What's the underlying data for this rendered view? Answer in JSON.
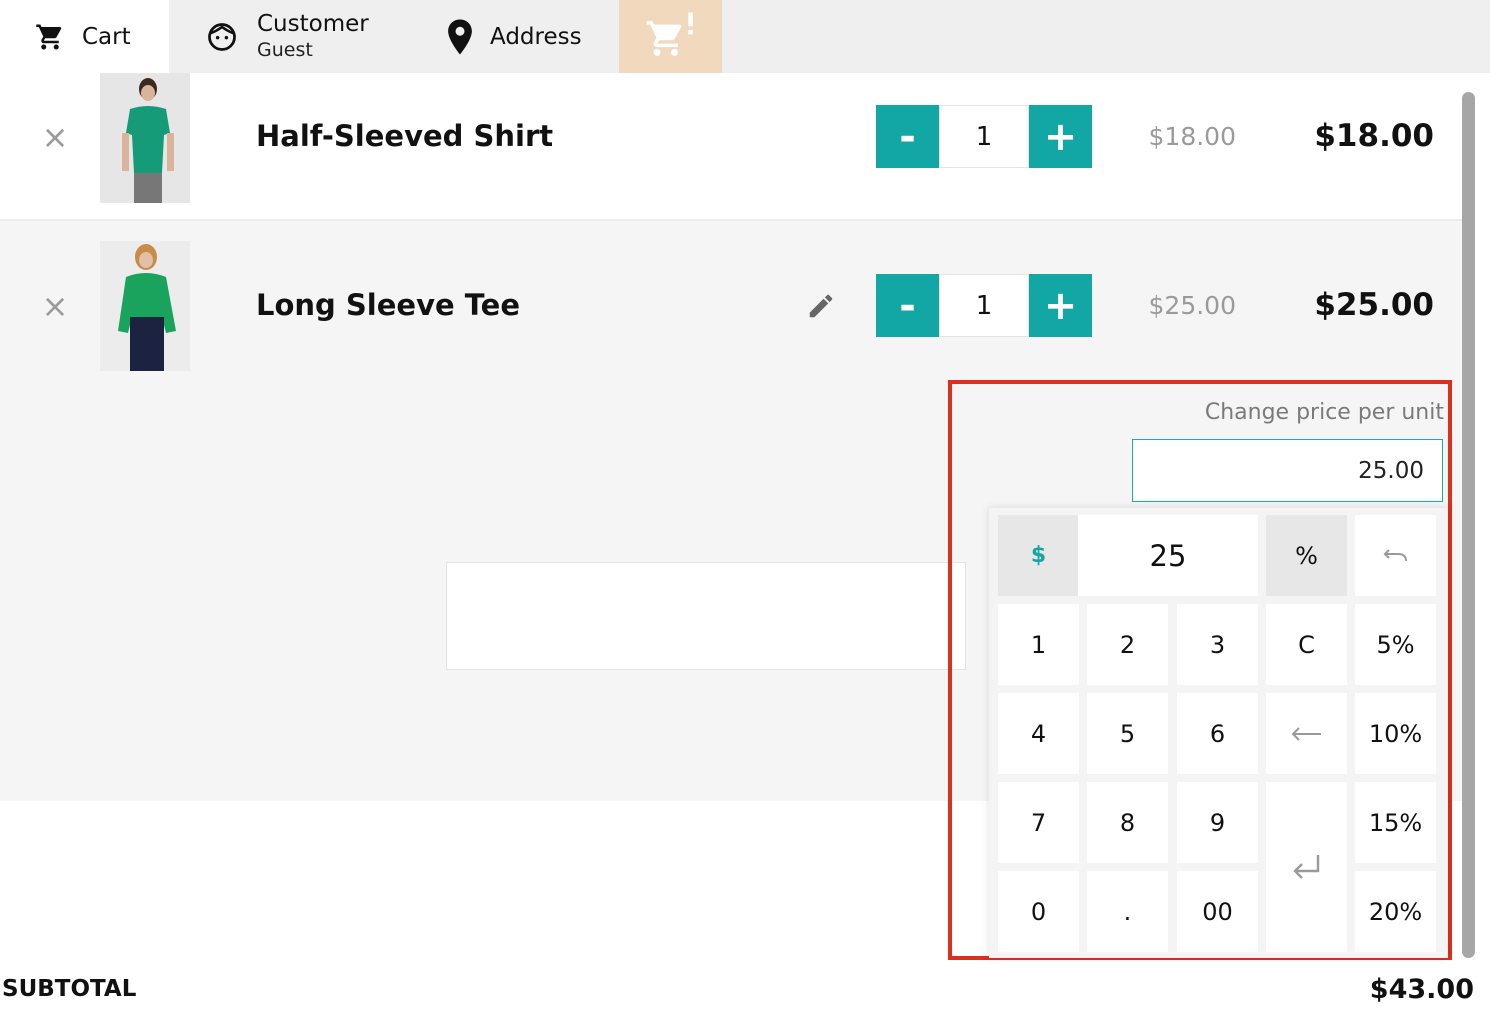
{
  "tabs": {
    "cart": {
      "label": "Cart",
      "icon": "cart-icon"
    },
    "customer": {
      "label": "Customer",
      "sub": "Guest",
      "icon": "smiley-icon"
    },
    "address": {
      "label": "Address",
      "icon": "location-pin-icon"
    },
    "alert": {
      "icon": "cart-alert-icon",
      "bg": "#f1d9bd"
    }
  },
  "cart": {
    "lines": [
      {
        "name": "Half-Sleeved Shirt",
        "qty": "1",
        "unit_price": "$18.00",
        "total": "$18.00"
      },
      {
        "name": "Long Sleeve Tee",
        "qty": "1",
        "unit_price": "$25.00",
        "total": "$25.00"
      }
    ],
    "qty_minus": "-",
    "qty_plus": "+",
    "remove_glyph": "×"
  },
  "price_editor": {
    "label": "Change price per unit",
    "value": "25.00",
    "display": "25",
    "mode_dollar": "$",
    "mode_percent": "%",
    "keys": {
      "k1": "1",
      "k2": "2",
      "k3": "3",
      "clear": "C",
      "p5": "5%",
      "k4": "4",
      "k5": "5",
      "k6": "6",
      "p10": "10%",
      "k7": "7",
      "k8": "8",
      "k9": "9",
      "p15": "15%",
      "k0": "0",
      "dot": ".",
      "k00": "00",
      "p20": "20%"
    }
  },
  "footer": {
    "subtotal_label": "SUBTOTAL",
    "subtotal_value": "$43.00"
  },
  "colors": {
    "accent": "#12a7a4",
    "highlight_border": "#d9311d"
  }
}
